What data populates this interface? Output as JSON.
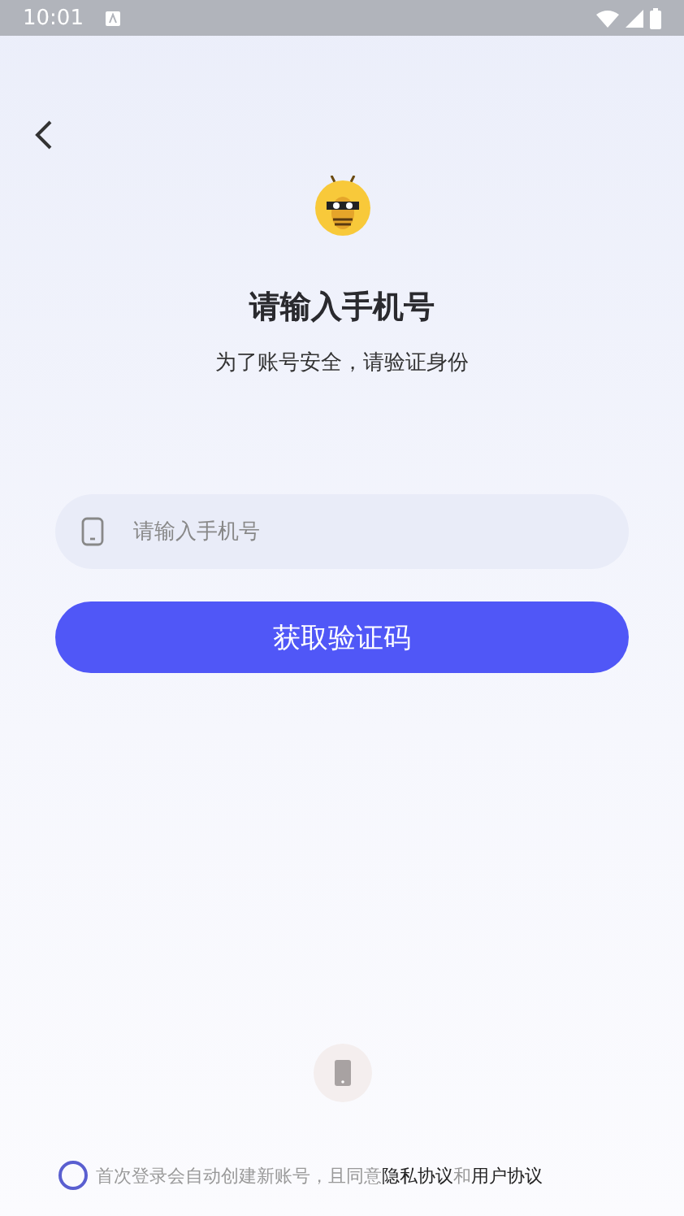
{
  "status_bar": {
    "time": "10:01"
  },
  "title": "请输入手机号",
  "subtitle": "为了账号安全，请验证身份",
  "phone_field": {
    "placeholder": "请输入手机号"
  },
  "submit_button": "获取验证码",
  "agreement": {
    "checked": false,
    "parts": [
      {
        "kind": "text",
        "text": "首次登录会自动创建新账号，且同意"
      },
      {
        "kind": "link",
        "text": "隐私协议"
      },
      {
        "kind": "text",
        "text": "和"
      },
      {
        "kind": "link",
        "text": "用户协议"
      }
    ]
  }
}
